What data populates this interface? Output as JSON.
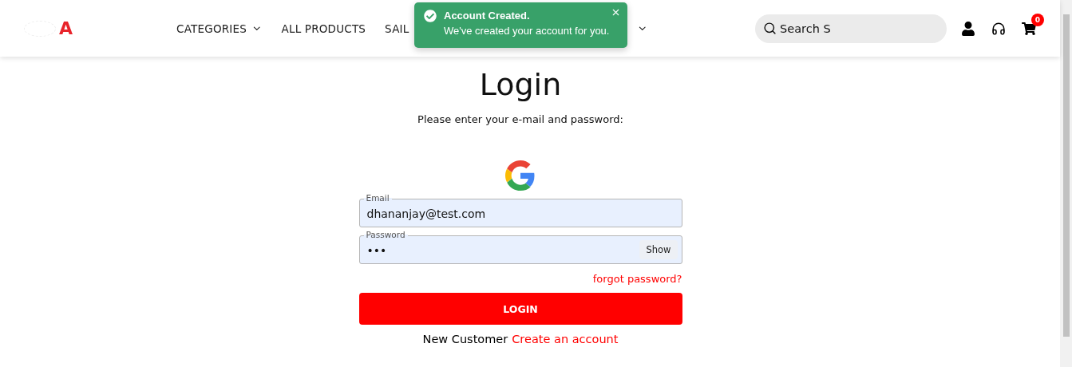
{
  "header": {
    "logo": "A",
    "nav": [
      {
        "label": "CATEGORIES",
        "dropdown": true
      },
      {
        "label": "ALL PRODUCTS",
        "dropdown": false
      },
      {
        "label": "SAIL",
        "dropdown": false
      }
    ],
    "hidden_nav_dropdown": true,
    "search": {
      "value": "Search S"
    },
    "cart_count": "0"
  },
  "toast": {
    "title": "Account Created.",
    "message": "We've created your account for you."
  },
  "login": {
    "title": "Login",
    "subtitle": "Please enter your e-mail and password:",
    "email": {
      "label": "Email",
      "value": "dhananjay@test.com"
    },
    "password": {
      "label": "Password",
      "value": "•••",
      "show_button": "Show"
    },
    "forgot": "forgot password?",
    "submit": "LOGIN",
    "new_customer": "New Customer",
    "create_account": "Create an account"
  }
}
